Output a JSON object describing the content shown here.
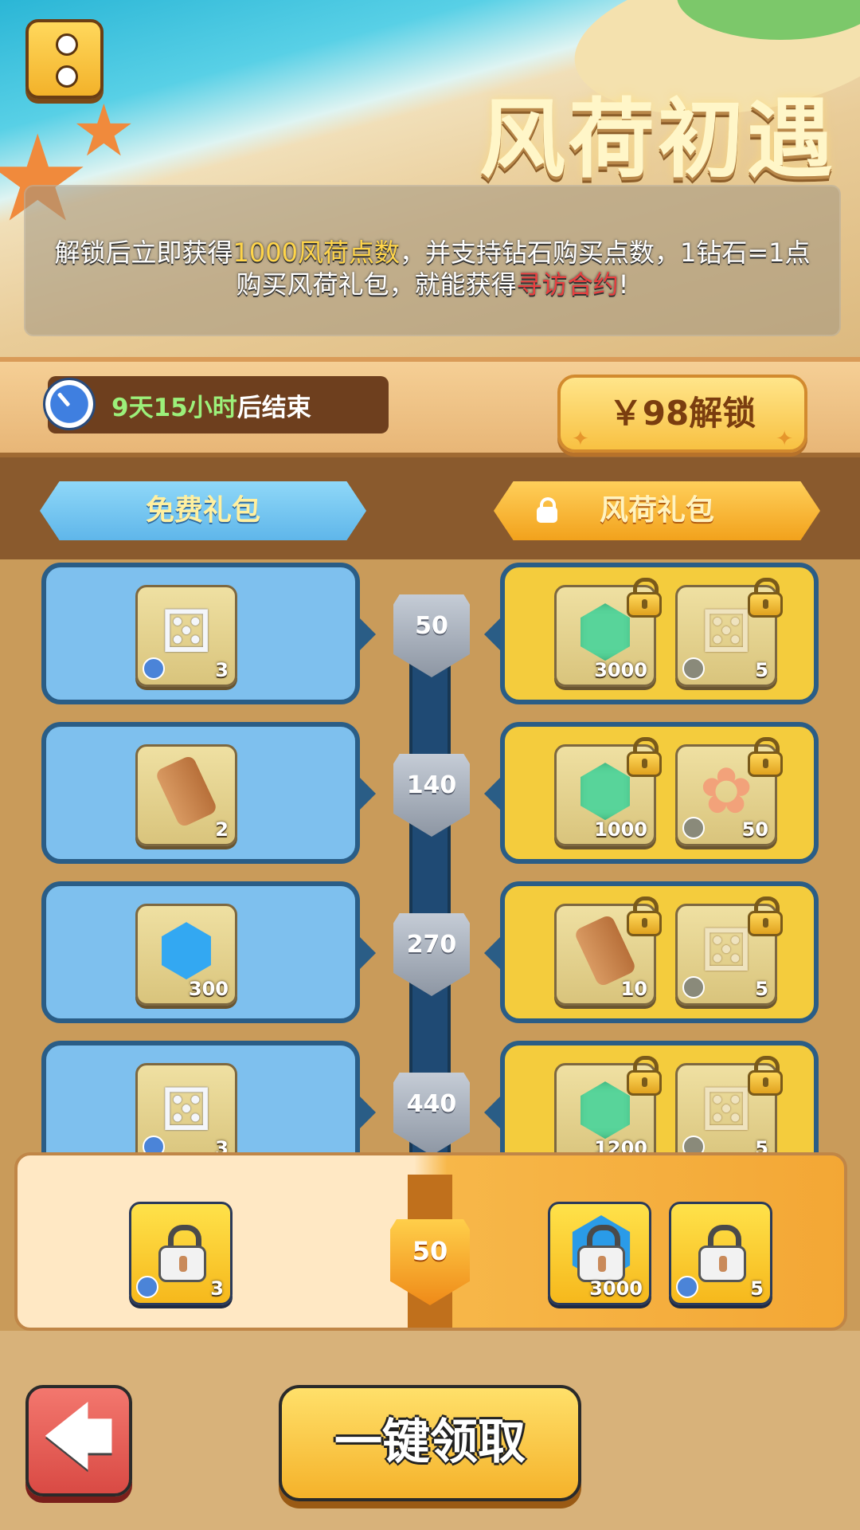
{
  "header": {
    "title": "风荷初遇",
    "desc_line1_a": "解锁后立即获得",
    "desc_line1_hl": "1000风荷点数",
    "desc_line1_b": "，并支持钻石购买点数，1钻石=1点",
    "desc_line2_a": "购买风荷礼包，就能获得",
    "desc_line2_hl": "寻访合约",
    "desc_line2_b": "!"
  },
  "timer": {
    "highlight": "9天15小时",
    "suffix": "后结束"
  },
  "unlock_button": {
    "label": "￥98解锁"
  },
  "tabs": {
    "free": "免费礼包",
    "paid": "风荷礼包"
  },
  "rows": [
    {
      "level": "50",
      "free": {
        "icon": "dice-icon",
        "qty": "3"
      },
      "paid": [
        {
          "icon": "gem-icon",
          "qty": "3000"
        },
        {
          "icon": "dice-icon",
          "qty": "5"
        }
      ]
    },
    {
      "level": "140",
      "free": {
        "icon": "scroll-icon",
        "qty": "2"
      },
      "paid": [
        {
          "icon": "gem-icon",
          "qty": "1000"
        },
        {
          "icon": "flower-icon",
          "qty": "50"
        }
      ]
    },
    {
      "level": "270",
      "free": {
        "icon": "gem-icon",
        "qty": "300"
      },
      "paid": [
        {
          "icon": "scroll-icon",
          "qty": "10"
        },
        {
          "icon": "dice-icon",
          "qty": "5"
        }
      ]
    },
    {
      "level": "440",
      "free": {
        "icon": "dice-icon",
        "qty": "3"
      },
      "paid": [
        {
          "icon": "gem-icon",
          "qty": "1200"
        },
        {
          "icon": "dice-icon",
          "qty": "5"
        }
      ]
    }
  ],
  "claim_bar": {
    "level": "50",
    "free_qty": "3",
    "paid_qty_1": "3000",
    "paid_qty_2": "5"
  },
  "buttons": {
    "back_icon": "🡄",
    "claim_all": "一键领取"
  },
  "colors": {
    "free_panel": "#7ec0ee",
    "paid_panel": "#f4cc3d",
    "track": "#1f4a74"
  }
}
